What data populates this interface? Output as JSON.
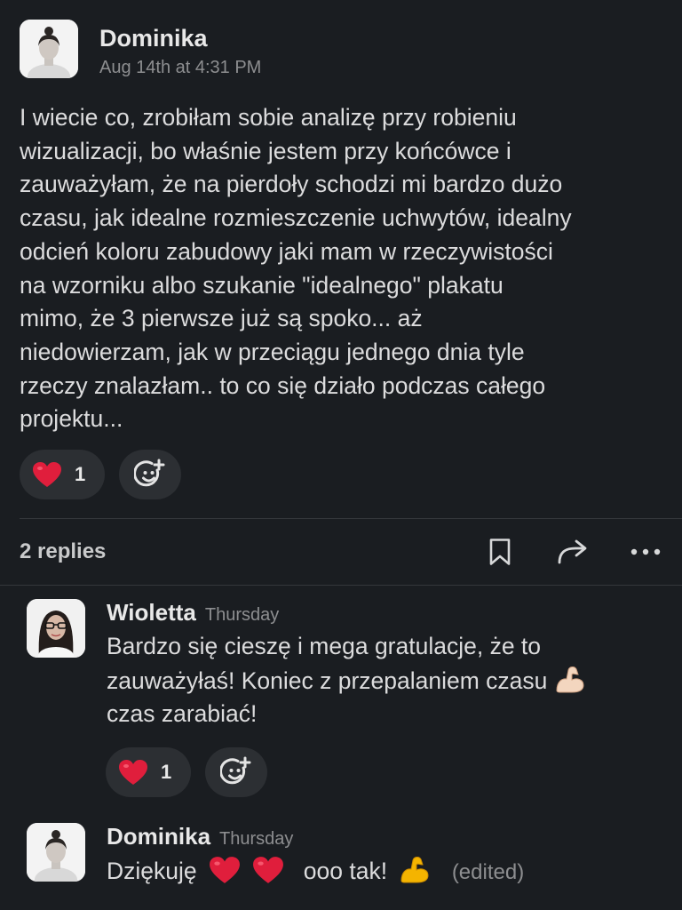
{
  "post": {
    "author": "Dominika",
    "time": "Aug 14th at 4:31 PM",
    "body": "I wiecie co, zrobiłam sobie analizę przy robieniu\nwizualizacji, bo właśnie jestem przy końcówce i\nzauważyłam, że na pierdoły schodzi mi bardzo dużo\nczasu, jak idealne rozmieszczenie uchwytów, idealny\nodcień koloru zabudowy jaki mam w rzeczywistości\nna wzorniku albo szukanie \"idealnego\" plakatu\nmimo, że 3 pierwsze już są spoko... aż\nniedowierzam, jak w przeciągu jednego dnia tyle\nrzeczy znalazłam.. to co się działo podczas całego\nprojektu...",
    "reaction": {
      "icon": "heart-emoji",
      "count": "1"
    }
  },
  "replies_bar": {
    "label": "2 replies",
    "icons": [
      "bookmark-icon",
      "share-icon",
      "more-icon"
    ]
  },
  "replies": [
    {
      "author": "Wioletta",
      "time": "Thursday",
      "text_line1": "Bardzo się cieszę i mega gratulacje, że to",
      "text_line2": "zauważyłaś! Koniec z przepalaniem czasu",
      "text_line3": "czas zarabiać!",
      "emoji": "flexed-biceps-light",
      "reaction": {
        "icon": "heart-emoji",
        "count": "1"
      }
    },
    {
      "author": "Dominika",
      "time": "Thursday",
      "text_start": "Dziękuję",
      "text_mid": "ooo tak!",
      "edited": "(edited)"
    }
  ],
  "colors": {
    "background": "#1a1d21",
    "pill": "#2c2f33",
    "heart": "#e01e3c",
    "muted": "#8d8e90"
  }
}
